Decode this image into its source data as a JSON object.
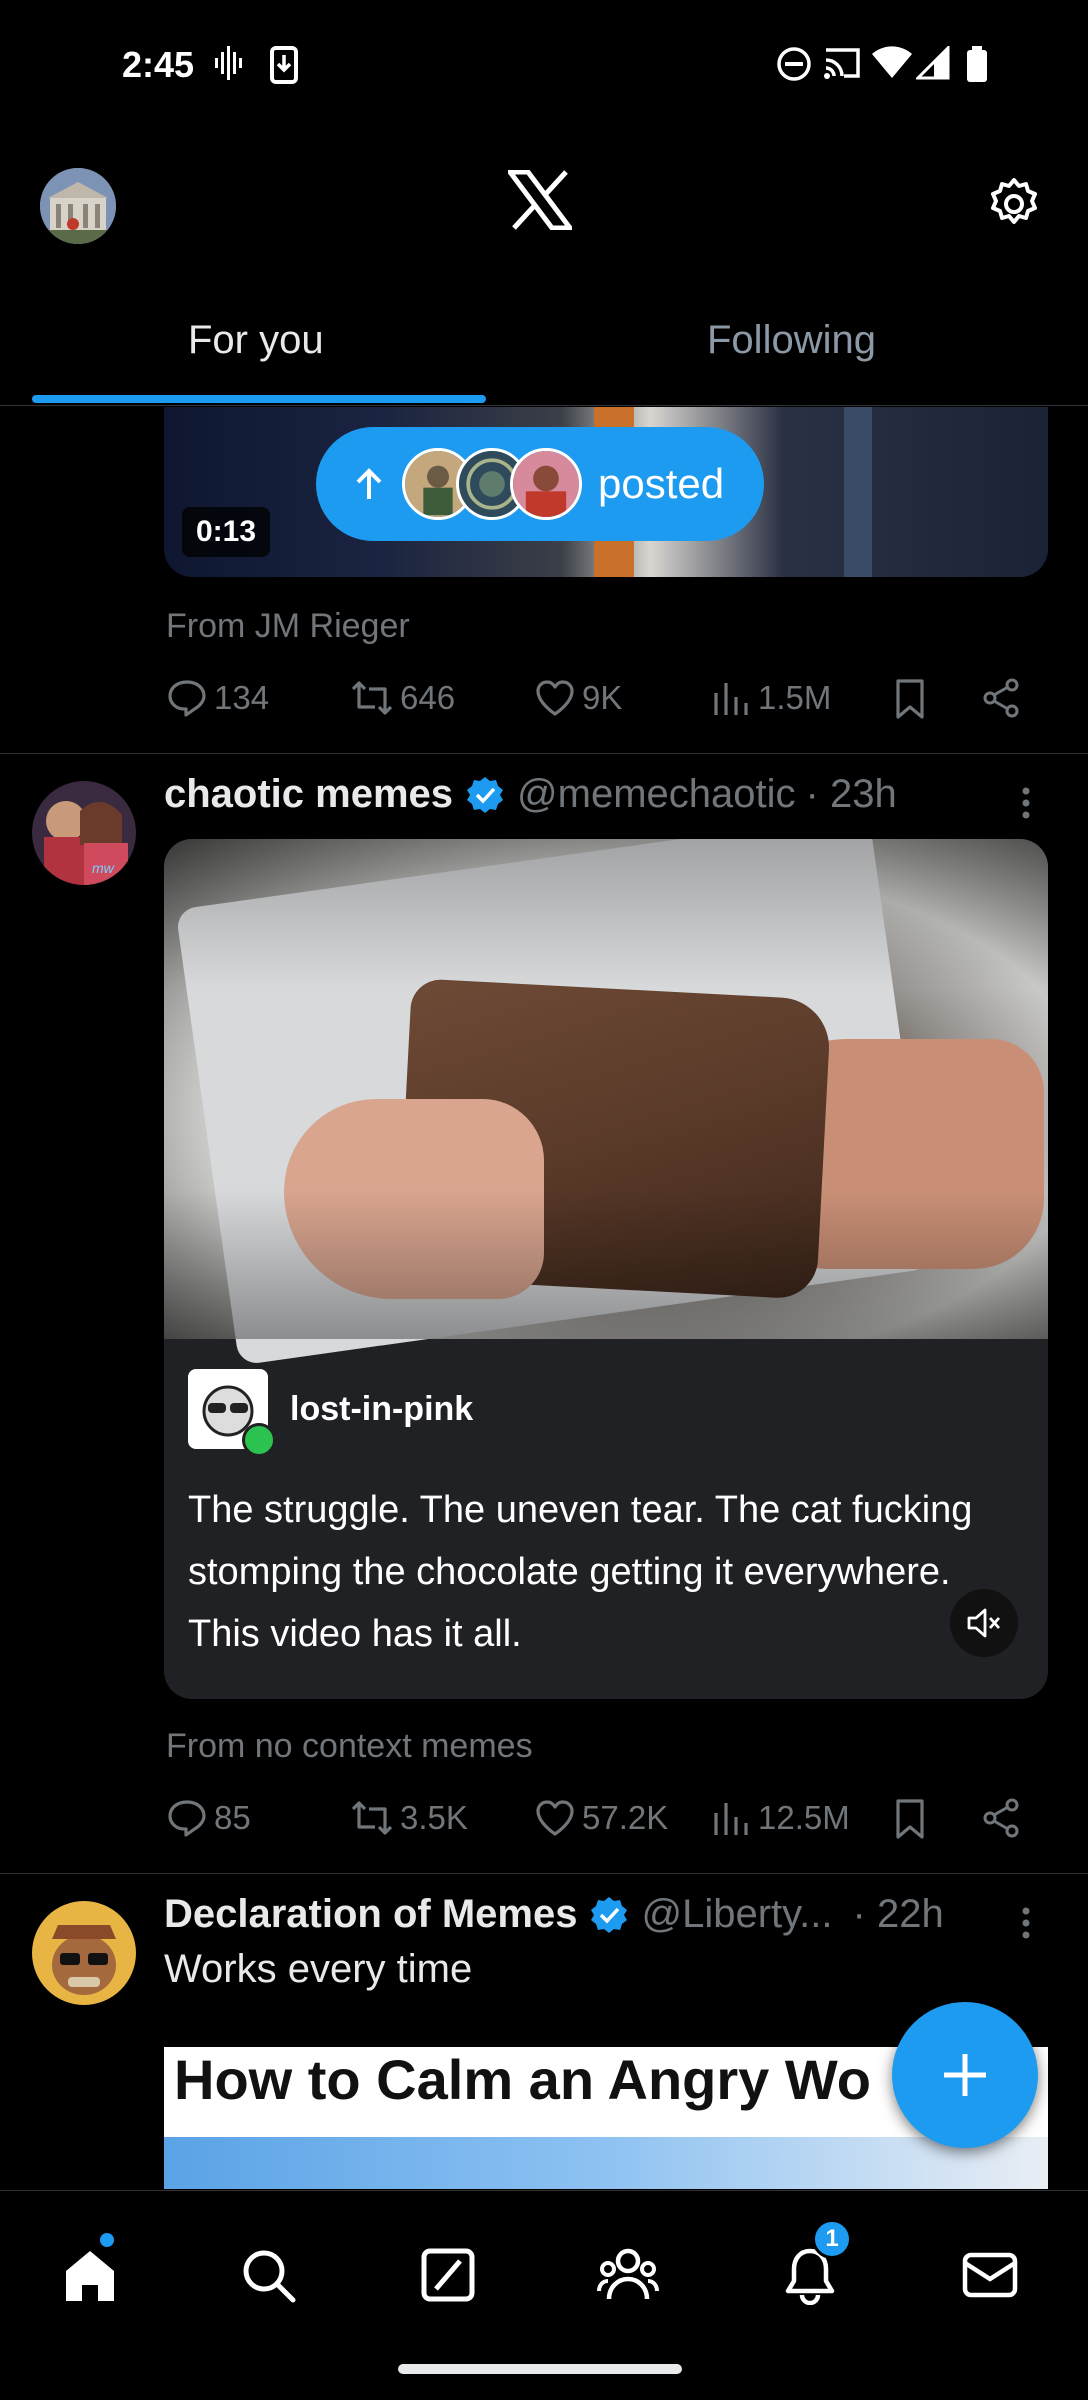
{
  "status_bar": {
    "time": "2:45"
  },
  "header": {
    "logo": "x-logo-icon",
    "settings_icon": "gear-icon"
  },
  "tabs": [
    {
      "label": "For you",
      "active": true
    },
    {
      "label": "Following",
      "active": false
    }
  ],
  "posted_pill": {
    "label": "posted"
  },
  "post1": {
    "duration": "0:13",
    "from": "From JM Rieger",
    "replies": "134",
    "reposts": "646",
    "likes": "9K",
    "views": "1.5M"
  },
  "post2": {
    "name": "chaotic memes",
    "handle": "@memechaotic",
    "time": "· 23h",
    "card_user": "lost-in-pink",
    "card_text": "The struggle. The uneven tear. The cat fucking stomping the chocolate getting it everywhere. This video has it all.",
    "from": "From no context memes",
    "replies": "85",
    "reposts": "3.5K",
    "likes": "57.2K",
    "views": "12.5M"
  },
  "post3": {
    "name": "Declaration of Memes",
    "handle": "@Liberty...",
    "time": "· 22h",
    "text": "Works every time",
    "media_text": "How to Calm an Angry Wo"
  },
  "bottom_nav": {
    "items": [
      "home-icon",
      "search-icon",
      "grok-icon",
      "communities-icon",
      "notifications-icon",
      "messages-icon"
    ],
    "notification_count": "1"
  },
  "colors": {
    "accent": "#1d9bf0",
    "background": "#000000",
    "muted": "#71767b"
  }
}
